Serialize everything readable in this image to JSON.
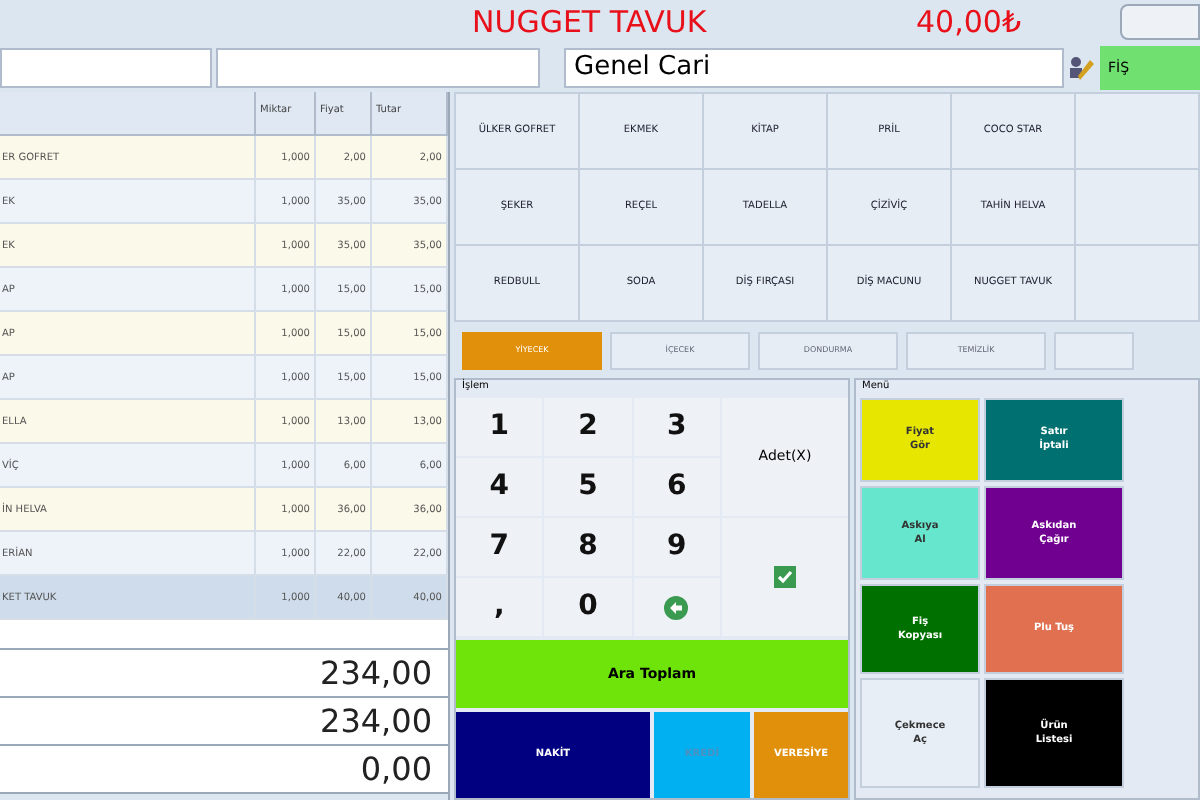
{
  "header": {
    "product_name": "NUGGET TAVUK",
    "price": "40,00₺"
  },
  "customer": {
    "value": "Genel Cari",
    "receipt_type": "FİŞ"
  },
  "table": {
    "columns": [
      "",
      "Miktar",
      "Fiyat",
      "Tutar"
    ],
    "rows": [
      {
        "cells": [
          "ER GOFRET",
          "1,000",
          "2,00",
          "2,00"
        ],
        "selected": false
      },
      {
        "cells": [
          "EK",
          "1,000",
          "35,00",
          "35,00"
        ],
        "selected": false
      },
      {
        "cells": [
          "EK",
          "1,000",
          "35,00",
          "35,00"
        ],
        "selected": false
      },
      {
        "cells": [
          "AP",
          "1,000",
          "15,00",
          "15,00"
        ],
        "selected": false
      },
      {
        "cells": [
          "AP",
          "1,000",
          "15,00",
          "15,00"
        ],
        "selected": false
      },
      {
        "cells": [
          "AP",
          "1,000",
          "15,00",
          "15,00"
        ],
        "selected": false
      },
      {
        "cells": [
          "ELLA",
          "1,000",
          "13,00",
          "13,00"
        ],
        "selected": false
      },
      {
        "cells": [
          "VİÇ",
          "1,000",
          "6,00",
          "6,00"
        ],
        "selected": false
      },
      {
        "cells": [
          "İN HELVA",
          "1,000",
          "36,00",
          "36,00"
        ],
        "selected": false
      },
      {
        "cells": [
          "ERİAN",
          "1,000",
          "22,00",
          "22,00"
        ],
        "selected": false
      },
      {
        "cells": [
          "KET TAVUK",
          "1,000",
          "40,00",
          "40,00"
        ],
        "selected": true
      }
    ]
  },
  "totals": [
    "234,00",
    "234,00",
    "0,00"
  ],
  "products": [
    "ÜLKER GOFRET",
    "EKMEK",
    "KİTAP",
    "PRİL",
    "COCO STAR",
    "ŞEKER",
    "REÇEL",
    "TADELLA",
    "ÇİZİVİÇ",
    "TAHİN HELVA",
    "REDBULL",
    "SODA",
    "DİŞ FIRÇASI",
    "DİŞ MACUNU",
    "NUGGET TAVUK"
  ],
  "categories": [
    {
      "label": "YİYECEK",
      "selected": true
    },
    {
      "label": "İÇECEK",
      "selected": false
    },
    {
      "label": "DONDURMA",
      "selected": false
    },
    {
      "label": "TEMİZLİK",
      "selected": false
    }
  ],
  "keypad": {
    "title": "İşlem",
    "keys": [
      {
        "kind": "digit",
        "label": "1"
      },
      {
        "kind": "digit",
        "label": "2"
      },
      {
        "kind": "digit",
        "label": "3"
      },
      {
        "kind": "digit",
        "label": "4"
      },
      {
        "kind": "digit",
        "label": "5"
      },
      {
        "kind": "digit",
        "label": "6"
      },
      {
        "kind": "digit",
        "label": "7"
      },
      {
        "kind": "digit",
        "label": "8"
      },
      {
        "kind": "digit",
        "label": "9"
      },
      {
        "kind": "digit",
        "label": ","
      },
      {
        "kind": "digit",
        "label": "0"
      },
      {
        "kind": "backspace"
      }
    ],
    "quantity_label": "Adet(X)",
    "subtotal_label": "Ara Toplam",
    "payments": [
      {
        "label": "NAKİT",
        "color": "#000080"
      },
      {
        "label": "KREDİ",
        "color": "#00b0f0"
      },
      {
        "label": "VERESİYE",
        "color": "#e0900a"
      }
    ]
  },
  "menu": {
    "title": "Menü",
    "buttons": [
      {
        "label": "Fiyat\nGör",
        "color": "#e6e600"
      },
      {
        "label": "Satır\nİptali",
        "color": "#007070"
      },
      {
        "label": "Askıya\nAl",
        "color": "#66e6cc"
      },
      {
        "label": "Askıdan\nÇağır",
        "color": "#700090"
      },
      {
        "label": "Fiş\nKopyası",
        "color": "#007000"
      },
      {
        "label": "Plu Tuş",
        "color": "#e07050"
      },
      {
        "label": "Çekmece\nAç",
        "color": "#e8eef5"
      },
      {
        "label": "Ürün\nListesi",
        "color": "#000000"
      }
    ]
  }
}
